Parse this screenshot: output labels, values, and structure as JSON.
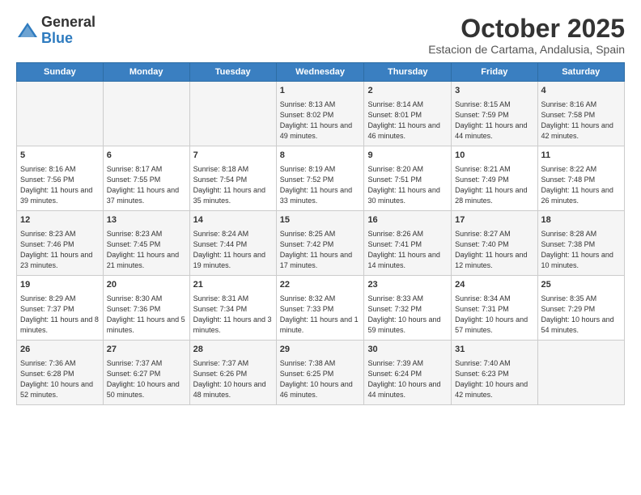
{
  "logo": {
    "general": "General",
    "blue": "Blue"
  },
  "title": "October 2025",
  "subtitle": "Estacion de Cartama, Andalusia, Spain",
  "days_of_week": [
    "Sunday",
    "Monday",
    "Tuesday",
    "Wednesday",
    "Thursday",
    "Friday",
    "Saturday"
  ],
  "weeks": [
    [
      {
        "day": "",
        "content": ""
      },
      {
        "day": "",
        "content": ""
      },
      {
        "day": "",
        "content": ""
      },
      {
        "day": "1",
        "content": "Sunrise: 8:13 AM\nSunset: 8:02 PM\nDaylight: 11 hours and 49 minutes."
      },
      {
        "day": "2",
        "content": "Sunrise: 8:14 AM\nSunset: 8:01 PM\nDaylight: 11 hours and 46 minutes."
      },
      {
        "day": "3",
        "content": "Sunrise: 8:15 AM\nSunset: 7:59 PM\nDaylight: 11 hours and 44 minutes."
      },
      {
        "day": "4",
        "content": "Sunrise: 8:16 AM\nSunset: 7:58 PM\nDaylight: 11 hours and 42 minutes."
      }
    ],
    [
      {
        "day": "5",
        "content": "Sunrise: 8:16 AM\nSunset: 7:56 PM\nDaylight: 11 hours and 39 minutes."
      },
      {
        "day": "6",
        "content": "Sunrise: 8:17 AM\nSunset: 7:55 PM\nDaylight: 11 hours and 37 minutes."
      },
      {
        "day": "7",
        "content": "Sunrise: 8:18 AM\nSunset: 7:54 PM\nDaylight: 11 hours and 35 minutes."
      },
      {
        "day": "8",
        "content": "Sunrise: 8:19 AM\nSunset: 7:52 PM\nDaylight: 11 hours and 33 minutes."
      },
      {
        "day": "9",
        "content": "Sunrise: 8:20 AM\nSunset: 7:51 PM\nDaylight: 11 hours and 30 minutes."
      },
      {
        "day": "10",
        "content": "Sunrise: 8:21 AM\nSunset: 7:49 PM\nDaylight: 11 hours and 28 minutes."
      },
      {
        "day": "11",
        "content": "Sunrise: 8:22 AM\nSunset: 7:48 PM\nDaylight: 11 hours and 26 minutes."
      }
    ],
    [
      {
        "day": "12",
        "content": "Sunrise: 8:23 AM\nSunset: 7:46 PM\nDaylight: 11 hours and 23 minutes."
      },
      {
        "day": "13",
        "content": "Sunrise: 8:23 AM\nSunset: 7:45 PM\nDaylight: 11 hours and 21 minutes."
      },
      {
        "day": "14",
        "content": "Sunrise: 8:24 AM\nSunset: 7:44 PM\nDaylight: 11 hours and 19 minutes."
      },
      {
        "day": "15",
        "content": "Sunrise: 8:25 AM\nSunset: 7:42 PM\nDaylight: 11 hours and 17 minutes."
      },
      {
        "day": "16",
        "content": "Sunrise: 8:26 AM\nSunset: 7:41 PM\nDaylight: 11 hours and 14 minutes."
      },
      {
        "day": "17",
        "content": "Sunrise: 8:27 AM\nSunset: 7:40 PM\nDaylight: 11 hours and 12 minutes."
      },
      {
        "day": "18",
        "content": "Sunrise: 8:28 AM\nSunset: 7:38 PM\nDaylight: 11 hours and 10 minutes."
      }
    ],
    [
      {
        "day": "19",
        "content": "Sunrise: 8:29 AM\nSunset: 7:37 PM\nDaylight: 11 hours and 8 minutes."
      },
      {
        "day": "20",
        "content": "Sunrise: 8:30 AM\nSunset: 7:36 PM\nDaylight: 11 hours and 5 minutes."
      },
      {
        "day": "21",
        "content": "Sunrise: 8:31 AM\nSunset: 7:34 PM\nDaylight: 11 hours and 3 minutes."
      },
      {
        "day": "22",
        "content": "Sunrise: 8:32 AM\nSunset: 7:33 PM\nDaylight: 11 hours and 1 minute."
      },
      {
        "day": "23",
        "content": "Sunrise: 8:33 AM\nSunset: 7:32 PM\nDaylight: 10 hours and 59 minutes."
      },
      {
        "day": "24",
        "content": "Sunrise: 8:34 AM\nSunset: 7:31 PM\nDaylight: 10 hours and 57 minutes."
      },
      {
        "day": "25",
        "content": "Sunrise: 8:35 AM\nSunset: 7:29 PM\nDaylight: 10 hours and 54 minutes."
      }
    ],
    [
      {
        "day": "26",
        "content": "Sunrise: 7:36 AM\nSunset: 6:28 PM\nDaylight: 10 hours and 52 minutes."
      },
      {
        "day": "27",
        "content": "Sunrise: 7:37 AM\nSunset: 6:27 PM\nDaylight: 10 hours and 50 minutes."
      },
      {
        "day": "28",
        "content": "Sunrise: 7:37 AM\nSunset: 6:26 PM\nDaylight: 10 hours and 48 minutes."
      },
      {
        "day": "29",
        "content": "Sunrise: 7:38 AM\nSunset: 6:25 PM\nDaylight: 10 hours and 46 minutes."
      },
      {
        "day": "30",
        "content": "Sunrise: 7:39 AM\nSunset: 6:24 PM\nDaylight: 10 hours and 44 minutes."
      },
      {
        "day": "31",
        "content": "Sunrise: 7:40 AM\nSunset: 6:23 PM\nDaylight: 10 hours and 42 minutes."
      },
      {
        "day": "",
        "content": ""
      }
    ]
  ]
}
